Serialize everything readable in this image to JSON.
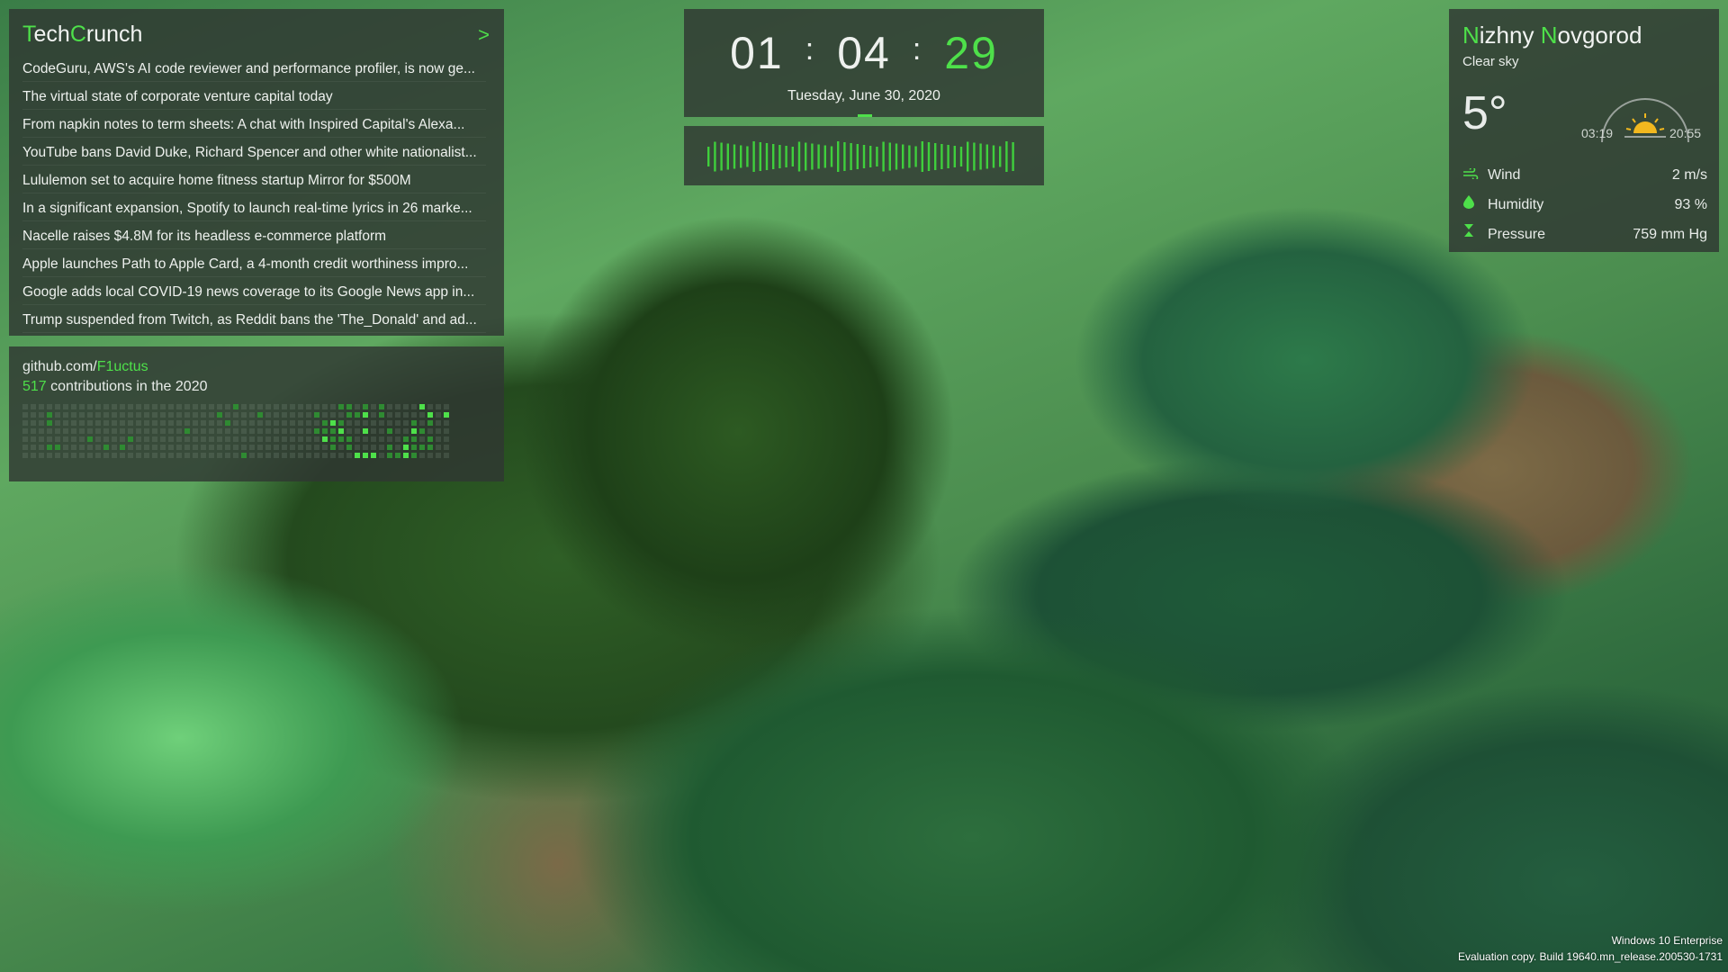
{
  "techcrunch": {
    "title_first": "T",
    "title_part1": "ech",
    "title_second": "C",
    "title_part2": "runch",
    "more_label": ">",
    "headlines": [
      "CodeGuru, AWS's AI code reviewer and performance profiler, is now ge...",
      "The virtual state of corporate venture capital today",
      "From napkin notes to term sheets: A chat with Inspired Capital's Alexa...",
      "YouTube bans David Duke, Richard Spencer and other white nationalist...",
      "Lululemon set to acquire home fitness startup Mirror for $500M",
      "In a significant expansion, Spotify to launch real-time lyrics in 26 marke...",
      "Nacelle raises $4.8M for its headless e-commerce platform",
      "Apple launches Path to Apple Card, a 4-month credit worthiness impro...",
      "Google adds local COVID-19 news coverage to its Google News app in...",
      "Trump suspended from Twitch, as Reddit bans the 'The_Donald' and ad..."
    ]
  },
  "github": {
    "prefix": "github.com/",
    "user": "F1uctus",
    "count": "517",
    "suffix": " contributions in the 2020"
  },
  "clock": {
    "hours": "01",
    "minutes": "04",
    "seconds": "29",
    "separator": ":",
    "date": "Tuesday, June 30, 2020"
  },
  "weather": {
    "city_first": "N",
    "city_part1": "izhny ",
    "city_second": "N",
    "city_part2": "ovgorod",
    "condition": "Clear sky",
    "temperature": "5°",
    "sunrise": "03:19",
    "sunset": "20:55",
    "details": [
      {
        "icon": "wind-icon",
        "label": "Wind",
        "value": "2 m/s"
      },
      {
        "icon": "humidity-icon",
        "label": "Humidity",
        "value": "93 %"
      },
      {
        "icon": "pressure-icon",
        "label": "Pressure",
        "value": "759 mm Hg"
      }
    ]
  },
  "watermark": {
    "line1": "Windows 10 Enterprise",
    "line2": "Evaluation copy. Build 19640.mn_release.200530-1731"
  },
  "colors": {
    "accent": "#4ee04a",
    "panel": "#303732"
  }
}
